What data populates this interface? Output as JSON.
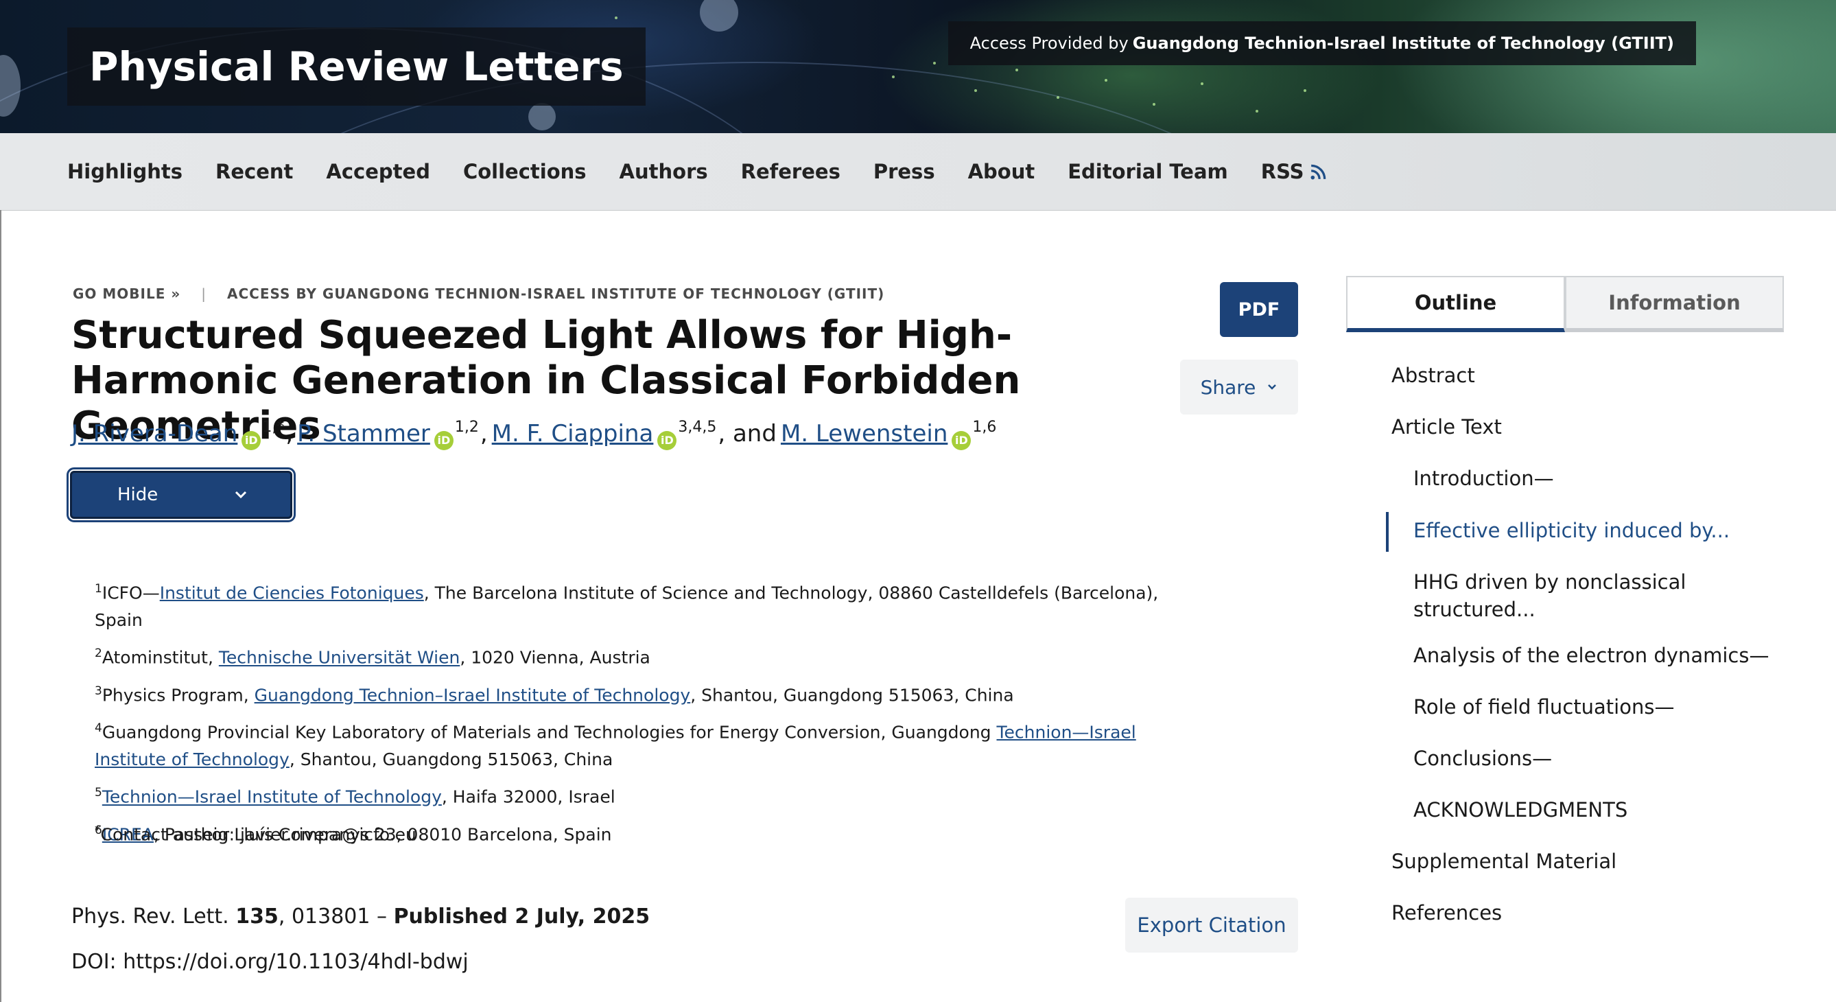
{
  "header": {
    "site_title": "Physical Review Letters",
    "access_prefix": "Access Provided by",
    "access_institution": "Guangdong Technion-Israel Institute of Technology (GTIIT)"
  },
  "nav": {
    "items": [
      "Highlights",
      "Recent",
      "Accepted",
      "Collections",
      "Authors",
      "Referees",
      "Press",
      "About",
      "Editorial Team",
      "RSS"
    ]
  },
  "breadcrumb": {
    "go_mobile": "GO MOBILE »",
    "access_by": "ACCESS BY GUANGDONG TECHNION-ISRAEL INSTITUTE OF TECHNOLOGY (GTIIT)"
  },
  "article": {
    "title": "Structured Squeezed Light Allows for High-Harmonic Generation in Classical Forbidden Geometries",
    "authors": [
      {
        "name": "J. Rivera-Dean",
        "affil": "1,*",
        "sep": ","
      },
      {
        "name": "P. Stammer",
        "affil": "1,2",
        "sep": ","
      },
      {
        "name": "M. F. Ciappina",
        "affil": "3,4,5",
        "sep": ", and"
      },
      {
        "name": "M. Lewenstein",
        "affil": "1,6",
        "sep": ""
      }
    ],
    "orcid_label": "iD",
    "hide_label": "Hide",
    "pdf_label": "PDF",
    "share_label": "Share",
    "export_label": "Export Citation",
    "affiliations": [
      {
        "num": "1",
        "pre": "ICFO—",
        "link": "Institut de Ciencies Fotoniques",
        "post": ", The Barcelona Institute of Science and Technology, 08860 Castelldefels (Barcelona), Spain"
      },
      {
        "num": "2",
        "pre": "Atominstitut, ",
        "link": "Technische Universität Wien",
        "post": ", 1020 Vienna, Austria"
      },
      {
        "num": "3",
        "pre": "Physics Program, ",
        "link": "Guangdong Technion–Israel Institute of Technology",
        "post": ", Shantou, Guangdong 515063, China"
      },
      {
        "num": "4",
        "pre": "Guangdong Provincial Key Laboratory of Materials and Technologies for Energy Conversion, Guangdong ",
        "link": "Technion—Israel Institute of Technology",
        "post": ", Shantou, Guangdong 515063, China"
      },
      {
        "num": "5",
        "pre": "",
        "link": "Technion—Israel Institute of Technology",
        "post": ", Haifa 32000, Israel"
      },
      {
        "num": "6",
        "pre": "",
        "link": "ICREA",
        "post": ", Passeig Lluís Companys 23, 08010 Barcelona, Spain"
      }
    ],
    "contact_mark": "*",
    "contact": "Contact author: javier.rivera@icfo.eu",
    "citation_journal": "Phys. Rev. Lett. ",
    "citation_volume": "135",
    "citation_rest": ", 013801 – ",
    "citation_published": "Published 2 July, 2025",
    "doi": "DOI: https://doi.org/10.1103/4hdl-bdwj"
  },
  "sidebar": {
    "tab_outline": "Outline",
    "tab_information": "Information",
    "outline": [
      {
        "label": "Abstract",
        "level": 1
      },
      {
        "label": "Article Text",
        "level": 1
      },
      {
        "label": "Introduction—",
        "level": 2
      },
      {
        "label": "Effective ellipticity induced by...",
        "level": 2,
        "active": true
      },
      {
        "label": "HHG driven by nonclassical structured...",
        "level": 2
      },
      {
        "label": "Analysis of the electron dynamics—",
        "level": 2
      },
      {
        "label": "Role of field fluctuations—",
        "level": 2
      },
      {
        "label": "Conclusions—",
        "level": 2
      },
      {
        "label": "ACKNOWLEDGMENTS",
        "level": 2
      },
      {
        "label": "Supplemental Material",
        "level": 1
      },
      {
        "label": "References",
        "level": 1
      }
    ]
  },
  "colors": {
    "accent": "#1c4278",
    "link": "#1f4e86",
    "orcid": "#a6ce39"
  }
}
